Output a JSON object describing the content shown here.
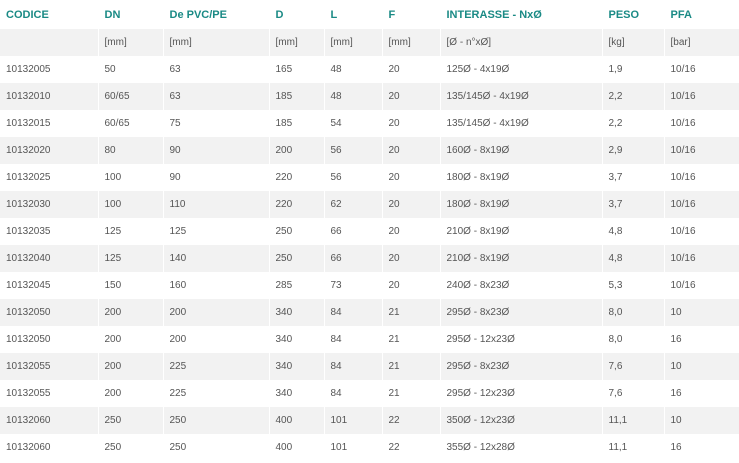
{
  "columns": [
    "CODICE",
    "DN",
    "De PVC/PE",
    "D",
    "L",
    "F",
    "INTERASSE - NxØ",
    "PESO",
    "PFA"
  ],
  "units": [
    "",
    "[mm]",
    "[mm]",
    "[mm]",
    "[mm]",
    "[mm]",
    "[Ø - n°xØ]",
    "[kg]",
    "[bar]"
  ],
  "rows": [
    [
      "10132005",
      "50",
      "63",
      "165",
      "48",
      "20",
      "125Ø - 4x19Ø",
      "1,9",
      "10/16"
    ],
    [
      "10132010",
      "60/65",
      "63",
      "185",
      "48",
      "20",
      "135/145Ø - 4x19Ø",
      "2,2",
      "10/16"
    ],
    [
      "10132015",
      "60/65",
      "75",
      "185",
      "54",
      "20",
      "135/145Ø - 4x19Ø",
      "2,2",
      "10/16"
    ],
    [
      "10132020",
      "80",
      "90",
      "200",
      "56",
      "20",
      "160Ø - 8x19Ø",
      "2,9",
      "10/16"
    ],
    [
      "10132025",
      "100",
      "90",
      "220",
      "56",
      "20",
      "180Ø - 8x19Ø",
      "3,7",
      "10/16"
    ],
    [
      "10132030",
      "100",
      "110",
      "220",
      "62",
      "20",
      "180Ø - 8x19Ø",
      "3,7",
      "10/16"
    ],
    [
      "10132035",
      "125",
      "125",
      "250",
      "66",
      "20",
      "210Ø - 8x19Ø",
      "4,8",
      "10/16"
    ],
    [
      "10132040",
      "125",
      "140",
      "250",
      "66",
      "20",
      "210Ø - 8x19Ø",
      "4,8",
      "10/16"
    ],
    [
      "10132045",
      "150",
      "160",
      "285",
      "73",
      "20",
      "240Ø - 8x23Ø",
      "5,3",
      "10/16"
    ],
    [
      "10132050",
      "200",
      "200",
      "340",
      "84",
      "21",
      "295Ø - 8x23Ø",
      "8,0",
      "10"
    ],
    [
      "10132050",
      "200",
      "200",
      "340",
      "84",
      "21",
      "295Ø - 12x23Ø",
      "8,0",
      "16"
    ],
    [
      "10132055",
      "200",
      "225",
      "340",
      "84",
      "21",
      "295Ø - 8x23Ø",
      "7,6",
      "10"
    ],
    [
      "10132055",
      "200",
      "225",
      "340",
      "84",
      "21",
      "295Ø - 12x23Ø",
      "7,6",
      "16"
    ],
    [
      "10132060",
      "250",
      "250",
      "400",
      "101",
      "22",
      "350Ø - 12x23Ø",
      "11,1",
      "10"
    ],
    [
      "10132060",
      "250",
      "250",
      "400",
      "101",
      "22",
      "355Ø - 12x28Ø",
      "11,1",
      "16"
    ]
  ],
  "colors": {
    "header_text": "#1a8a85",
    "body_text": "#555555",
    "stripe": "#f2f2f2",
    "background": "#ffffff"
  }
}
